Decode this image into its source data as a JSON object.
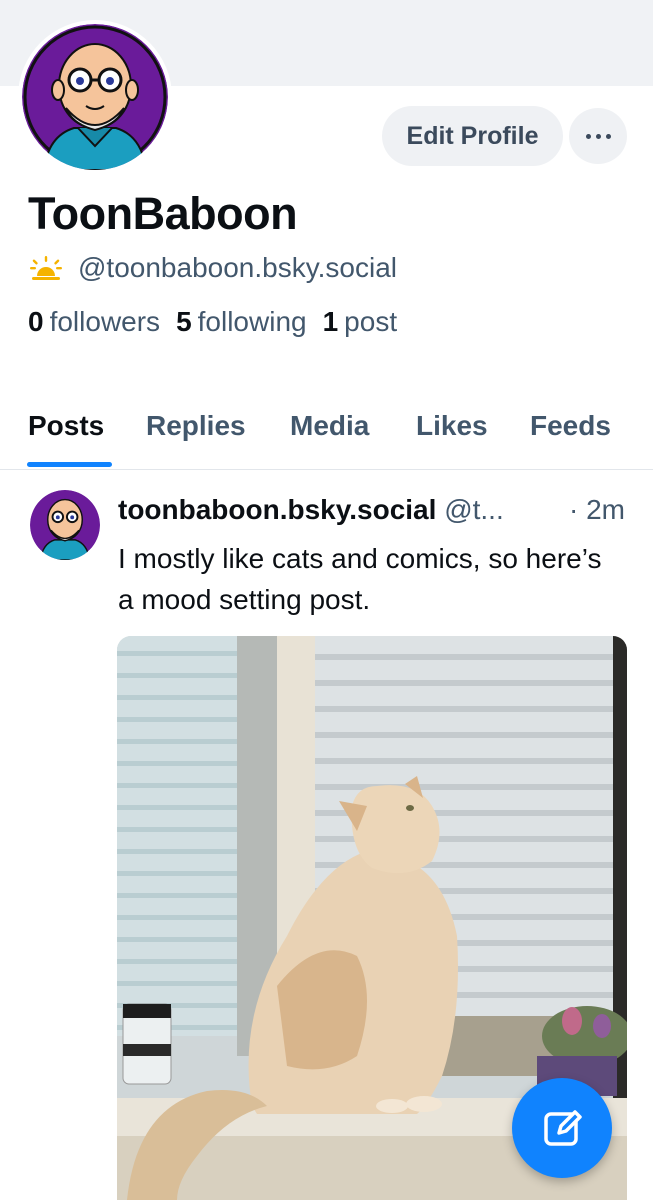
{
  "profile": {
    "display_name": "ToonBaboon",
    "handle": "@toonbaboon.bsky.social",
    "handle_icon": "sun-icon",
    "followers_count": "0",
    "followers_label": "followers",
    "following_count": "5",
    "following_label": "following",
    "posts_count": "1",
    "posts_label": "post",
    "edit_button_label": "Edit Profile"
  },
  "tabs": [
    {
      "label": "Posts",
      "active": true
    },
    {
      "label": "Replies",
      "active": false
    },
    {
      "label": "Media",
      "active": false
    },
    {
      "label": "Likes",
      "active": false
    },
    {
      "label": "Feeds",
      "active": false
    }
  ],
  "post": {
    "author_name": "toonbaboon.bsky.social",
    "author_handle": "@t...",
    "time": "· 2m",
    "text": "I mostly like cats and comics, so here’s a mood setting post.",
    "image_alt": "cat sitting on a window sill"
  },
  "colors": {
    "accent": "#1083fe",
    "avatar_bg": "#6a1b9a",
    "muted_text": "#42576c",
    "sun_icon": "#f5b300"
  },
  "icons": {
    "more": "ellipsis-icon",
    "compose": "compose-icon"
  }
}
